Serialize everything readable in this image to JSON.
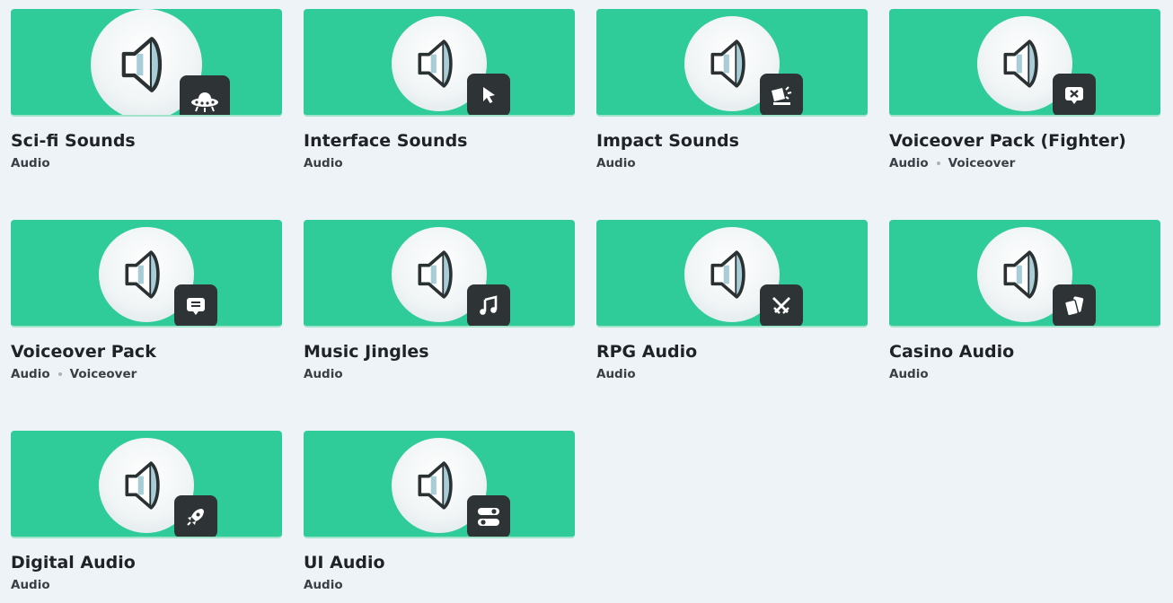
{
  "assets": [
    {
      "title": "Sci-fi Sounds",
      "category": "Audio",
      "subcategory": "",
      "badge_icon": "ufo-icon"
    },
    {
      "title": "Interface Sounds",
      "category": "Audio",
      "subcategory": "",
      "badge_icon": "cursor-icon"
    },
    {
      "title": "Impact Sounds",
      "category": "Audio",
      "subcategory": "",
      "badge_icon": "impact-icon"
    },
    {
      "title": "Voiceover Pack (Fighter)",
      "category": "Audio",
      "subcategory": "Voiceover",
      "badge_icon": "speech-cross-icon"
    },
    {
      "title": "Voiceover Pack",
      "category": "Audio",
      "subcategory": "Voiceover",
      "badge_icon": "speech-bubble-icon"
    },
    {
      "title": "Music Jingles",
      "category": "Audio",
      "subcategory": "",
      "badge_icon": "music-note-icon"
    },
    {
      "title": "RPG Audio",
      "category": "Audio",
      "subcategory": "",
      "badge_icon": "crossed-swords-icon"
    },
    {
      "title": "Casino Audio",
      "category": "Audio",
      "subcategory": "",
      "badge_icon": "cards-icon"
    },
    {
      "title": "Digital Audio",
      "category": "Audio",
      "subcategory": "",
      "badge_icon": "rocket-icon"
    },
    {
      "title": "UI Audio",
      "category": "Audio",
      "subcategory": "",
      "badge_icon": "toggles-icon"
    }
  ],
  "colors": {
    "banner": "#2fcc9a",
    "background": "#eef3f8",
    "badge": "#2e3436",
    "text": "#1f2328"
  }
}
